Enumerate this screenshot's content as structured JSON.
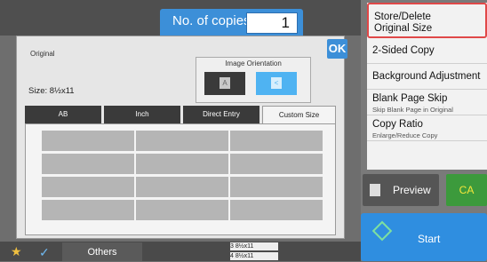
{
  "copies": {
    "label": "No. of copies",
    "value": "1"
  },
  "menu": [
    {
      "title": "Store/Delete\nOriginal Size",
      "subtitle": ""
    },
    {
      "title": "2-Sided Copy",
      "subtitle": ""
    },
    {
      "title": "Background Adjustment",
      "subtitle": ""
    },
    {
      "title": "Blank Page Skip",
      "subtitle": "Skip Blank Page in Original"
    },
    {
      "title": "Copy Ratio",
      "subtitle": "Enlarge/Reduce Copy"
    }
  ],
  "buttons": {
    "preview": "Preview",
    "ca": "CA",
    "start": "Start",
    "ok": "OK",
    "others": "Others"
  },
  "dialog": {
    "title": "Original",
    "size": "Size: 8½x11",
    "orientation_label": "Image Orientation",
    "tabs": [
      "AB",
      "Inch",
      "Direct Entry",
      "Custom Size"
    ],
    "selected_tab": "Custom Size"
  },
  "trays": [
    {
      "label": "3   8½x11"
    },
    {
      "label": "4   8½x11"
    }
  ],
  "colors": {
    "accent": "#3c8fd8",
    "highlight": "#e04848",
    "ca": "#3c9a3c",
    "start": "#2f8ee0"
  }
}
